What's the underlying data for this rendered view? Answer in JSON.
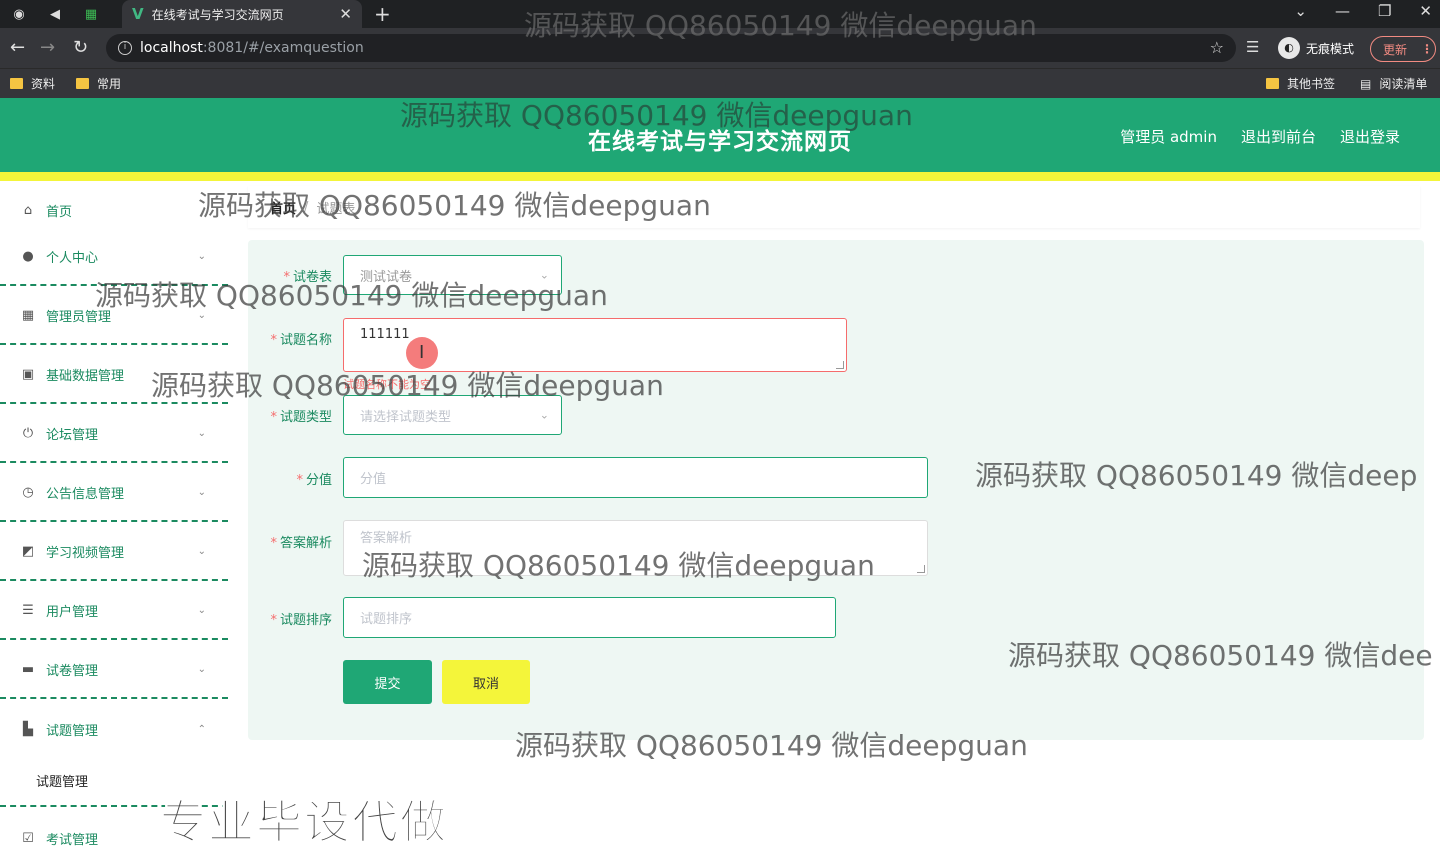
{
  "browser": {
    "tab_title": "在线考试与学习交流网页",
    "url_host": "localhost",
    "url_path": ":8081/#/examquestion",
    "incognito_label": "无痕模式",
    "update_label": "更新",
    "bookmarks": [
      "资料",
      "常用"
    ],
    "bookmarks_right": [
      "其他书签",
      "阅读清单"
    ]
  },
  "header": {
    "title": "在线考试与学习交流网页",
    "admin_label": "管理员 admin",
    "to_front_label": "退出到前台",
    "logout_label": "退出登录"
  },
  "sidebar": {
    "items": [
      {
        "label": "首页",
        "icon": "home-icon",
        "has_chevron": false
      },
      {
        "label": "个人中心",
        "icon": "user-icon",
        "has_chevron": true
      },
      {
        "label": "管理员管理",
        "icon": "grid-icon",
        "has_chevron": true
      },
      {
        "label": "基础数据管理",
        "icon": "clipboard-icon",
        "has_chevron": true
      },
      {
        "label": "论坛管理",
        "icon": "power-icon",
        "has_chevron": true
      },
      {
        "label": "公告信息管理",
        "icon": "clock-icon",
        "has_chevron": true
      },
      {
        "label": "学习视频管理",
        "icon": "chart-icon",
        "has_chevron": true
      },
      {
        "label": "用户管理",
        "icon": "list-icon",
        "has_chevron": true
      },
      {
        "label": "试卷管理",
        "icon": "comment-icon",
        "has_chevron": true
      },
      {
        "label": "试题管理",
        "icon": "briefcase-icon",
        "has_chevron": true,
        "expanded": true
      },
      {
        "label": "考试管理",
        "icon": "check-icon",
        "has_chevron": false
      }
    ],
    "subitem": "试题管理"
  },
  "breadcrumb": {
    "home": "首页",
    "current": "试题表"
  },
  "form": {
    "paper_label": "试卷表",
    "paper_value": "测试试卷",
    "name_label": "试题名称",
    "name_value": "111111",
    "name_error": "试题名称不能为空",
    "type_label": "试题类型",
    "type_placeholder": "请选择试题类型",
    "score_label": "分值",
    "score_placeholder": "分值",
    "analysis_label": "答案解析",
    "analysis_placeholder": "答案解析",
    "order_label": "试题排序",
    "order_placeholder": "试题排序",
    "submit_label": "提交",
    "cancel_label": "取消"
  },
  "watermarks": {
    "text": "源码获取 QQ86050149 微信deepguan",
    "text_cut1": "源码获取 QQ86050149 微信deep",
    "text_cut2": "源码获取 QQ86050149 微信dee",
    "big": "专业毕设代做"
  },
  "colors": {
    "brand_green": "#1fa775",
    "accent_yellow": "#f4f53a",
    "error_red": "#f56c6c"
  }
}
